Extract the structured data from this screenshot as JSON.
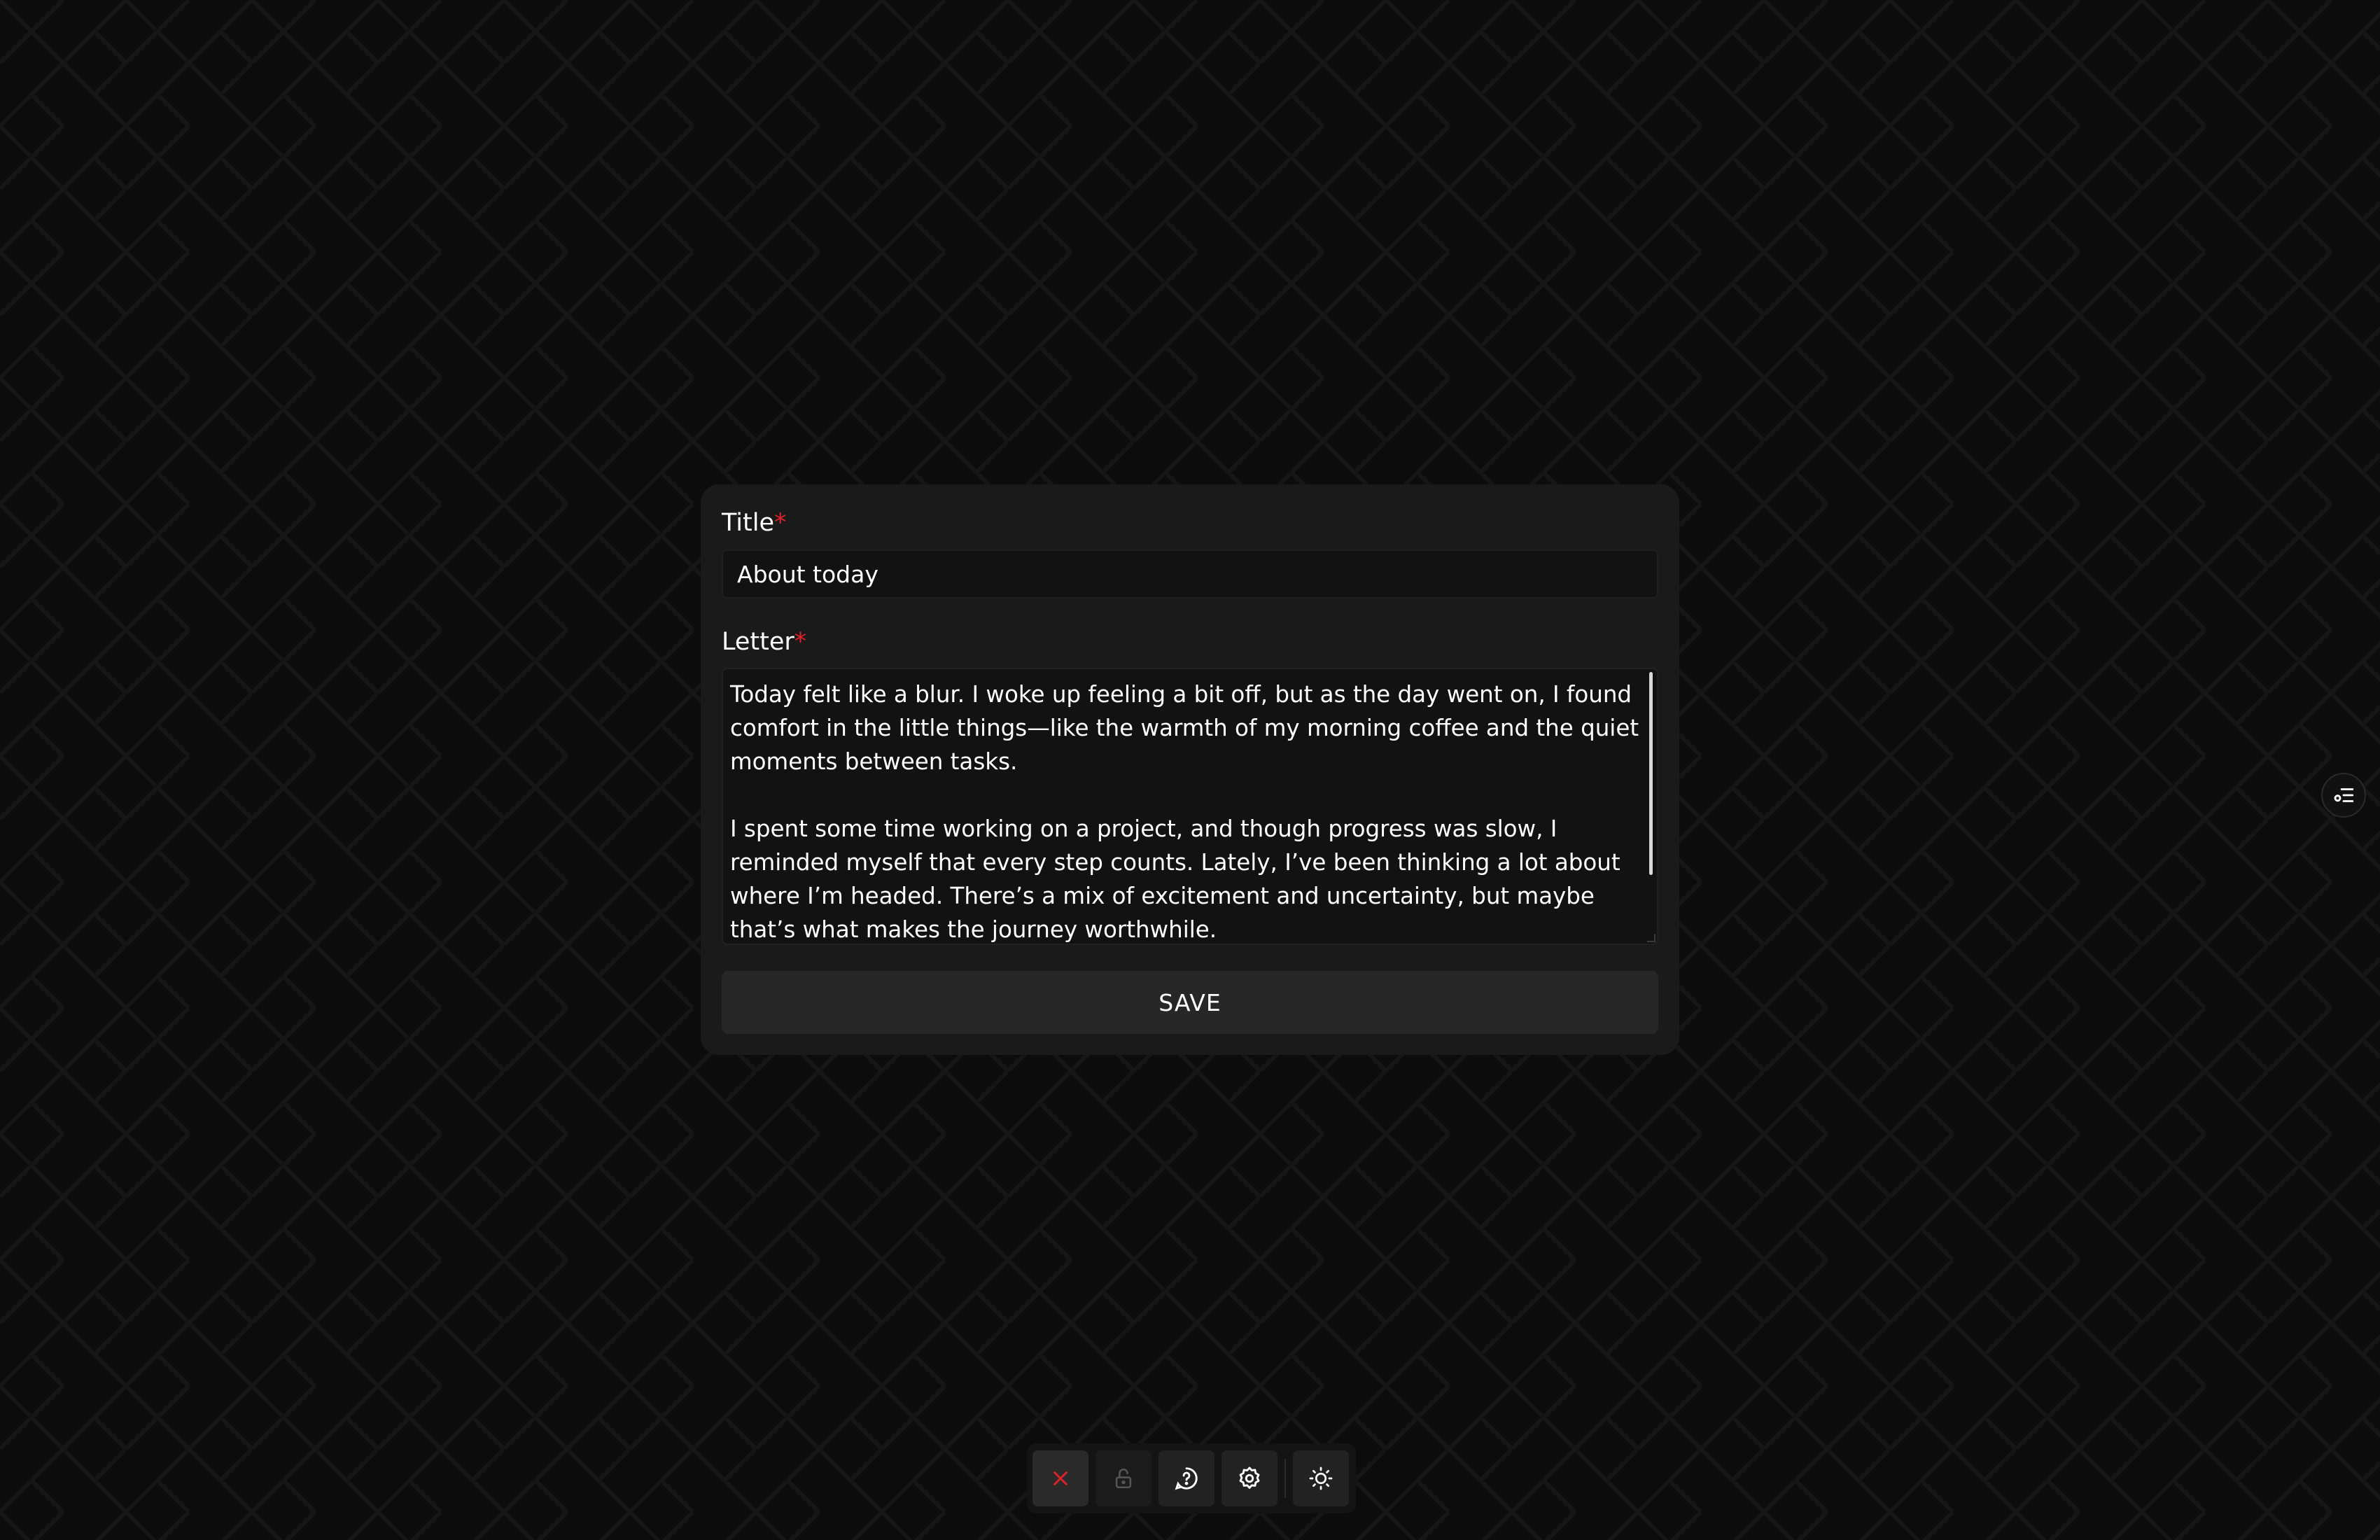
{
  "form": {
    "title_label": "Title",
    "title_required_mark": "*",
    "title_value": "About today",
    "letter_label": "Letter",
    "letter_required_mark": "*",
    "letter_value": "Today felt like a blur. I woke up feeling a bit off, but as the day went on, I found comfort in the little things—like the warmth of my morning coffee and the quiet moments between tasks.\n\nI spent some time working on a project, and though progress was slow, I reminded myself that every step counts. Lately, I’ve been thinking a lot about where I’m headed. There’s a mix of excitement and uncertainty, but maybe that’s what makes the journey worthwhile.",
    "save_label": "SAVE"
  },
  "side_toggle": {
    "icon": "list-settings-icon"
  },
  "toolbar": {
    "buttons": [
      {
        "icon": "close-x-icon",
        "color": "#e0202a"
      },
      {
        "icon": "lock-icon",
        "color": "#555555"
      },
      {
        "icon": "help-chat-icon",
        "color": "#ffffff"
      },
      {
        "icon": "gear-icon",
        "color": "#ffffff"
      },
      {
        "icon": "sun-icon",
        "color": "#ffffff"
      }
    ]
  },
  "colors": {
    "background": "#0c0c0c",
    "card": "#1a1a1a",
    "input": "#121212",
    "button": "#272727",
    "required": "#e0202a"
  }
}
